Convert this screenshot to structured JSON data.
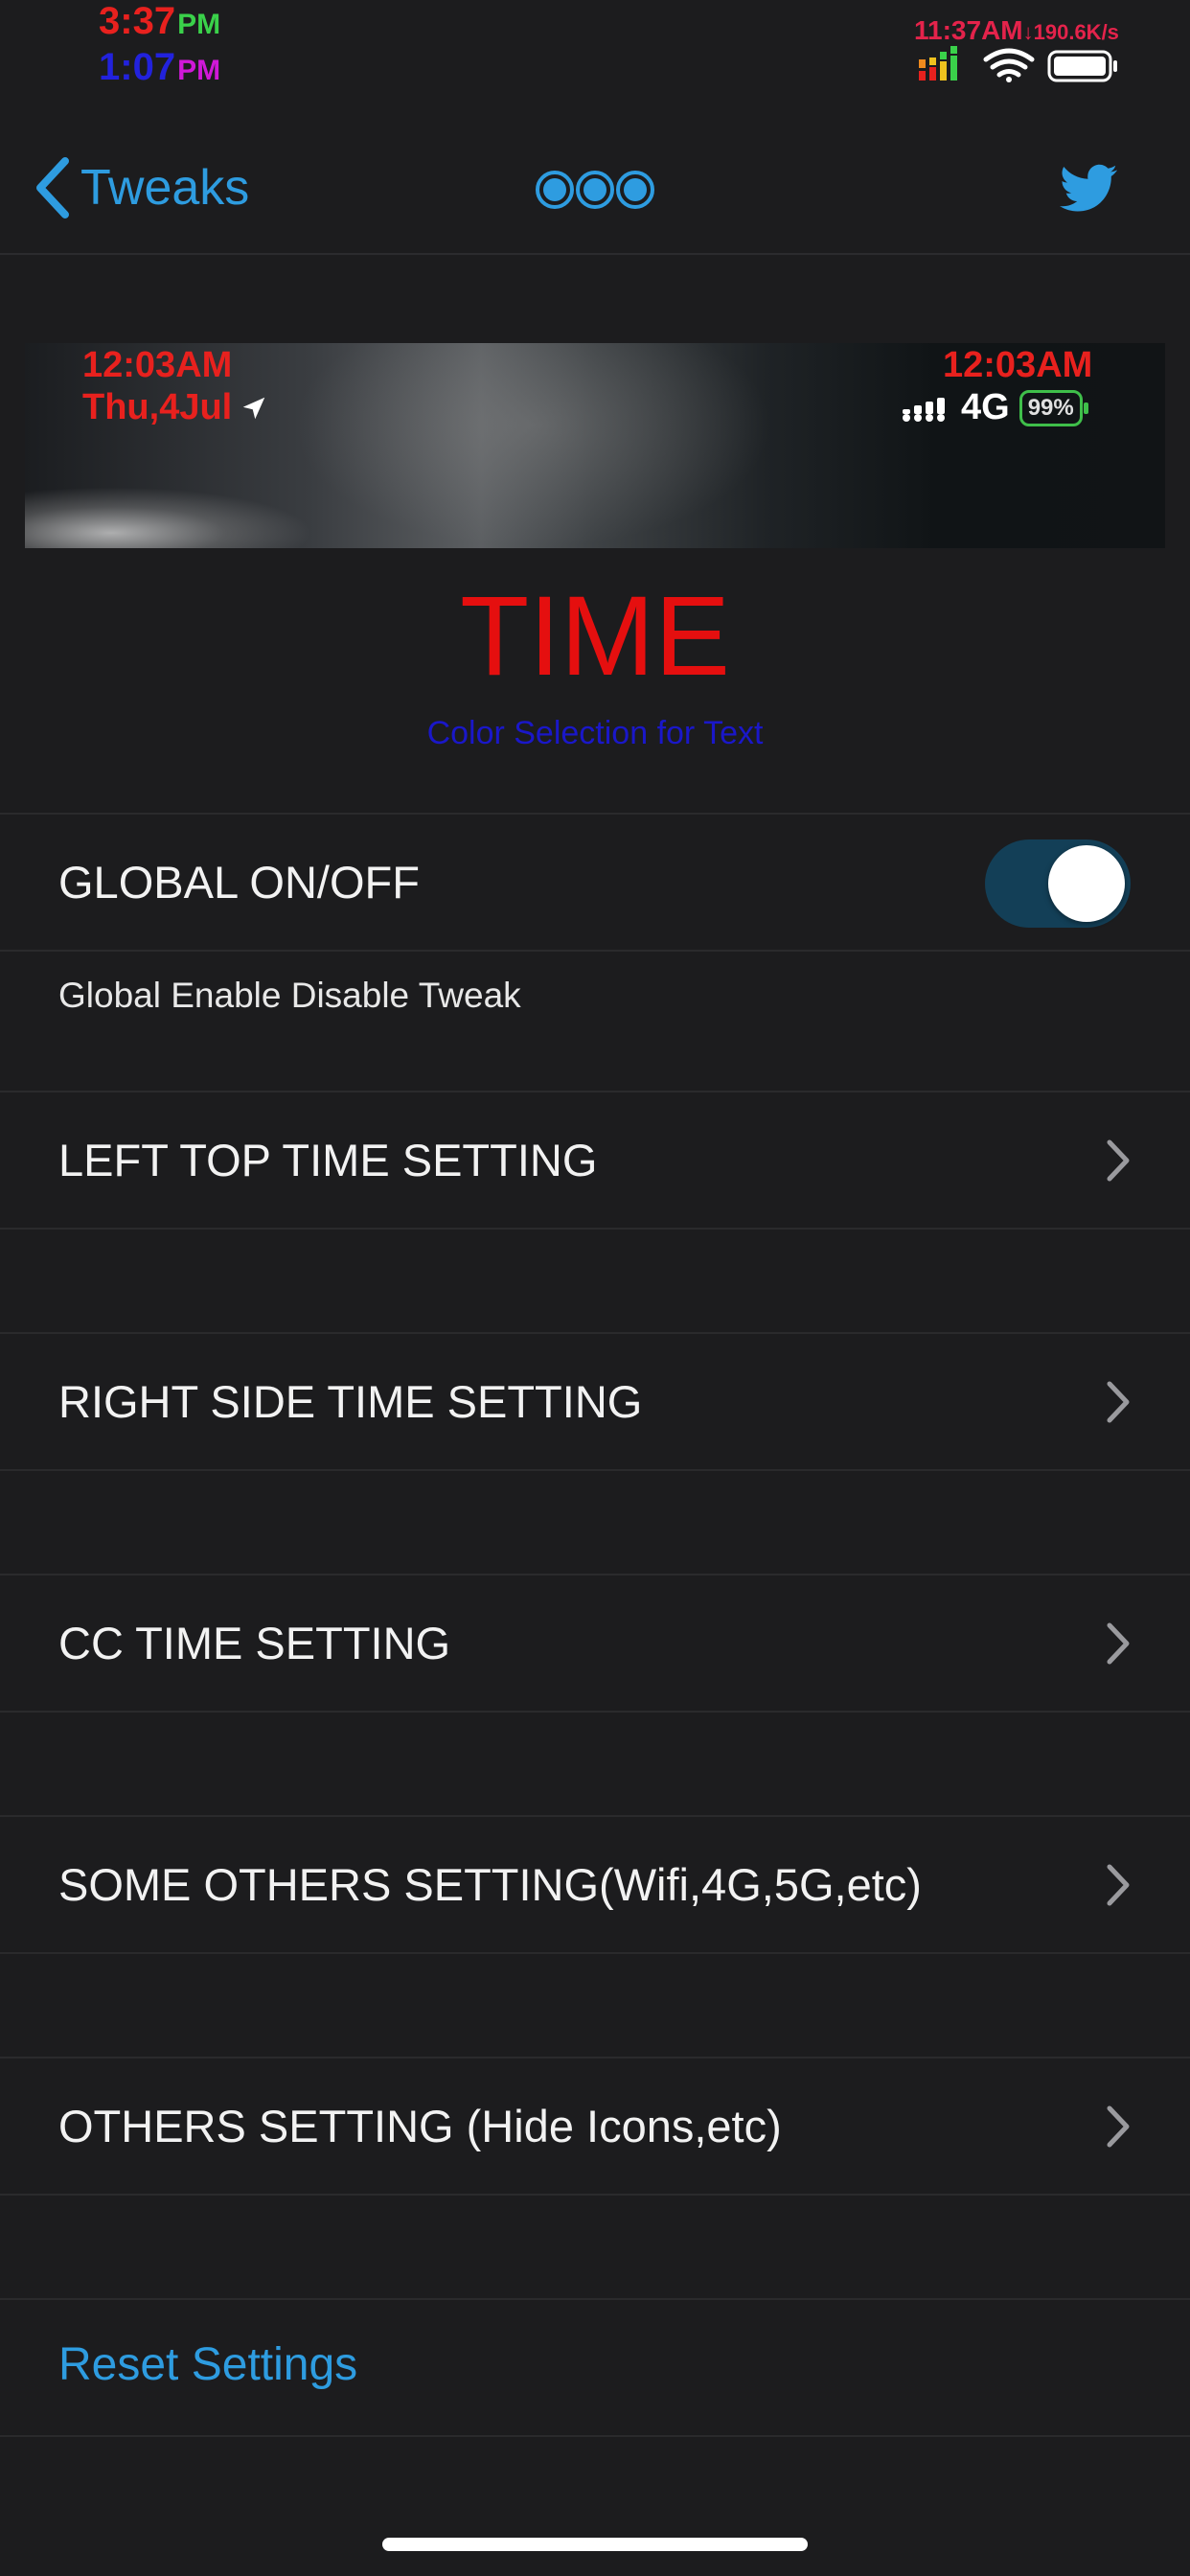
{
  "status_bar": {
    "time_primary": "3:37",
    "time_primary_suffix": "PM",
    "time_secondary": "1:07",
    "time_secondary_suffix": "PM",
    "clock_right": "11:37AM",
    "net_speed": "↓190.6K/s",
    "icons": [
      "signal-bars-icon",
      "wifi-icon",
      "battery-icon"
    ]
  },
  "nav": {
    "back_label": "Tweaks",
    "center_icon": "three-dots-logo",
    "right_icon": "twitter-icon"
  },
  "banner": {
    "left_time": "12:03AM",
    "left_date": "Thu,4Jul",
    "right_time": "12:03AM",
    "network": "4G",
    "battery": "99%"
  },
  "header": {
    "title": "TIME",
    "subtitle": "Color Selection for Text"
  },
  "global": {
    "label": "GLOBAL ON/OFF",
    "enabled": true,
    "note": "Global Enable Disable Tweak"
  },
  "menu": {
    "left_top": "LEFT TOP TIME SETTING",
    "right_side": "RIGHT SIDE TIME SETTING",
    "cc": "CC TIME SETTING",
    "some_others": "SOME OTHERS SETTING(Wifi,4G,5G,etc)",
    "others": "OTHERS SETTING (Hide Icons,etc)"
  },
  "reset_label": "Reset Settings",
  "colors": {
    "accent": "#2e9ce0",
    "title_red": "#e50f0f",
    "subtitle_blue": "#1a17c9",
    "toggle_on": "#133f57",
    "background": "#1c1c1e"
  }
}
